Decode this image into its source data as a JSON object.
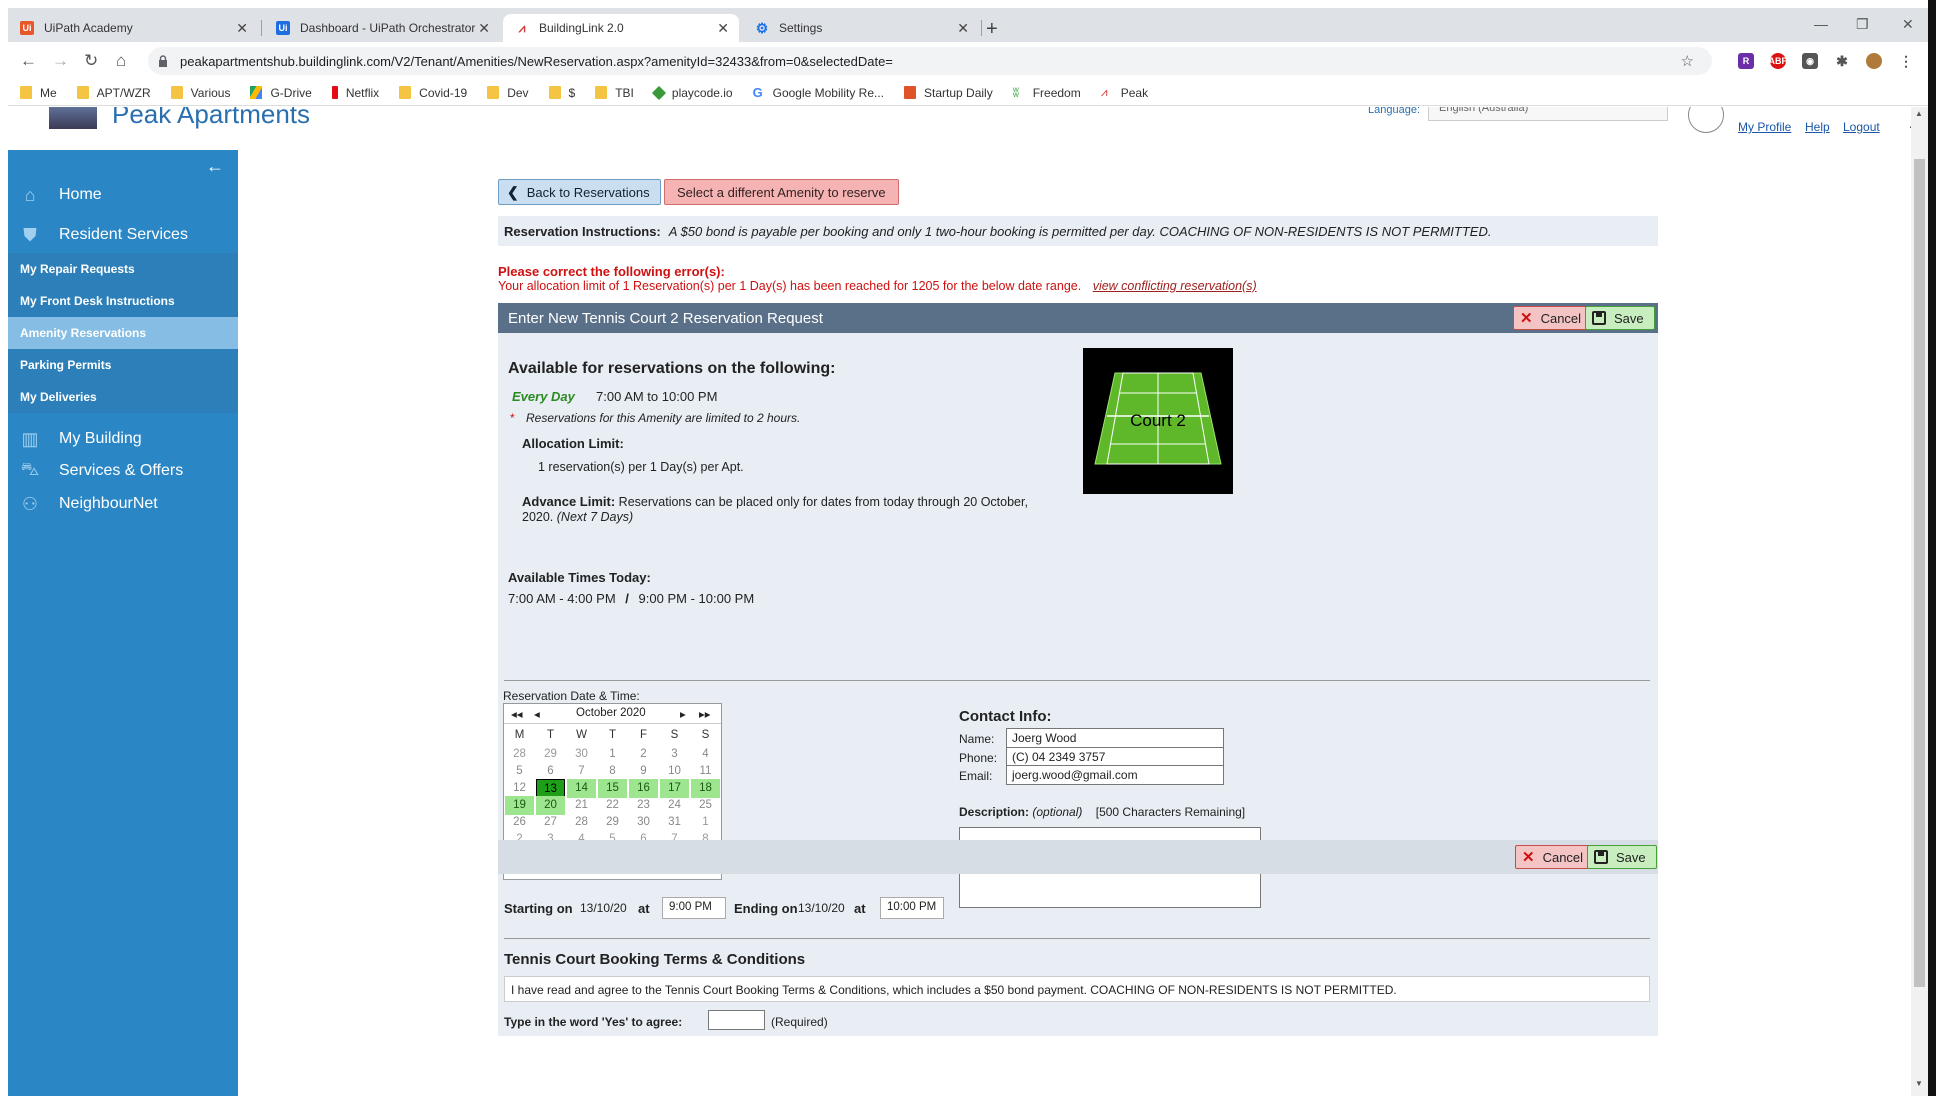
{
  "browser": {
    "tabs": [
      {
        "label": "UiPath Academy",
        "icon": "uipath-icon",
        "color": "#e8562a"
      },
      {
        "label": "Dashboard - UiPath Orchestrator",
        "icon": "uipath-icon",
        "color": "#1f6ee0"
      },
      {
        "label": "BuildingLink 2.0",
        "icon": "buildinglink-icon",
        "color": "#d23a3a"
      },
      {
        "label": "Settings",
        "icon": "gear-icon",
        "color": "#1a73e8"
      }
    ],
    "url": "peakapartmentshub.buildinglink.com/V2/Tenant/Amenities/NewReservation.aspx?amenityId=32433&from=0&selectedDate=",
    "bookmarks": [
      "Me",
      "APT/WZR",
      "Various",
      "G-Drive",
      "Netflix",
      "Covid-19",
      "Dev",
      "$",
      "TBI",
      "playcode.io",
      "Google Mobility Re...",
      "Startup Daily",
      "Freedom",
      "Peak"
    ]
  },
  "header": {
    "site_name": "Peak Apartments",
    "language_label": "Language:",
    "language_value": "English (Australia)",
    "links": [
      "My Profile",
      "Help",
      "Logout"
    ]
  },
  "sidebar": {
    "main": [
      {
        "label": "Home",
        "icon": "home-icon"
      },
      {
        "label": "Resident Services",
        "icon": "concierge-icon"
      }
    ],
    "sub": [
      "My Repair Requests",
      "My Front Desk Instructions",
      "Amenity Reservations",
      "Parking Permits",
      "My Deliveries"
    ],
    "main2": [
      {
        "label": "My Building",
        "icon": "building-icon"
      },
      {
        "label": "Services & Offers",
        "icon": "basket-icon"
      },
      {
        "label": "NeighbourNet",
        "icon": "people-icon"
      }
    ]
  },
  "actions": {
    "back": "Back to Reservations",
    "different": "Select a different Amenity to reserve"
  },
  "instructions": {
    "label": "Reservation Instructions:",
    "text": "A $50 bond is payable per booking and only 1 two-hour booking is permitted per day. COACHING OF NON-RESIDENTS IS NOT PERMITTED."
  },
  "error": {
    "heading": "Please correct the following error(s):",
    "message": "Your allocation limit of 1 Reservation(s) per 1 Day(s) has been reached for 1205 for the below date range.",
    "link": "view conflicting reservation(s)"
  },
  "form": {
    "title": "Enter New Tennis Court 2 Reservation Request",
    "cancel": "Cancel",
    "save": "Save",
    "available_title": "Available for reservations on the following:",
    "every_day": "Every Day",
    "hours": "7:00 AM to 10:00 PM",
    "limit_note": "Reservations for this Amenity are limited to 2 hours.",
    "alloc_label": "Allocation Limit:",
    "alloc_value": "1 reservation(s) per 1 Day(s) per Apt.",
    "advance_label": "Advance Limit:",
    "advance_text": "Reservations can be placed only for dates from today through 20 October, 2020.",
    "advance_note": "(Next 7 Days)",
    "court_label": "Court 2",
    "times_title": "Available Times Today:",
    "times_1": "7:00 AM - 4:00 PM",
    "times_sep": "/",
    "times_2": "9:00 PM - 10:00 PM",
    "dt_label": "Reservation Date & Time:",
    "calendar": {
      "month": "October 2020",
      "days": [
        "M",
        "T",
        "W",
        "T",
        "F",
        "S",
        "S"
      ],
      "weeks": [
        [
          "28",
          "29",
          "30",
          "1",
          "2",
          "3",
          "4"
        ],
        [
          "5",
          "6",
          "7",
          "8",
          "9",
          "10",
          "11"
        ],
        [
          "12",
          "13",
          "14",
          "15",
          "16",
          "17",
          "18"
        ],
        [
          "19",
          "20",
          "21",
          "22",
          "23",
          "24",
          "25"
        ],
        [
          "26",
          "27",
          "28",
          "29",
          "30",
          "31",
          "1"
        ],
        [
          "2",
          "3",
          "4",
          "5",
          "6",
          "7",
          "8"
        ]
      ],
      "selected": "13",
      "available": [
        "14",
        "15",
        "16",
        "17",
        "18",
        "19",
        "20"
      ]
    },
    "starting_label": "Starting on",
    "starting_date": "13/10/20",
    "at": "at",
    "starting_time": "9:00 PM",
    "ending_label": "Ending on",
    "ending_date": "13/10/20",
    "ending_time": "10:00 PM",
    "contact_title": "Contact Info:",
    "name_label": "Name:",
    "name_value": "Joerg Wood",
    "phone_label": "Phone:",
    "phone_value": "(C) 04 2349 3757",
    "email_label": "Email:",
    "email_value": "joerg.wood@gmail.com",
    "desc_label": "Description:",
    "desc_optional": "(optional)",
    "desc_remaining": "[500 Characters Remaining]",
    "terms_title": "Tennis Court Booking Terms & Conditions",
    "terms_text": "I have read and agree to the Tennis Court Booking Terms & Conditions, which includes a $50 bond payment. COACHING OF NON-RESIDENTS IS NOT PERMITTED.",
    "agree_label": "Type in the word 'Yes' to agree:",
    "agree_required": "(Required)"
  }
}
